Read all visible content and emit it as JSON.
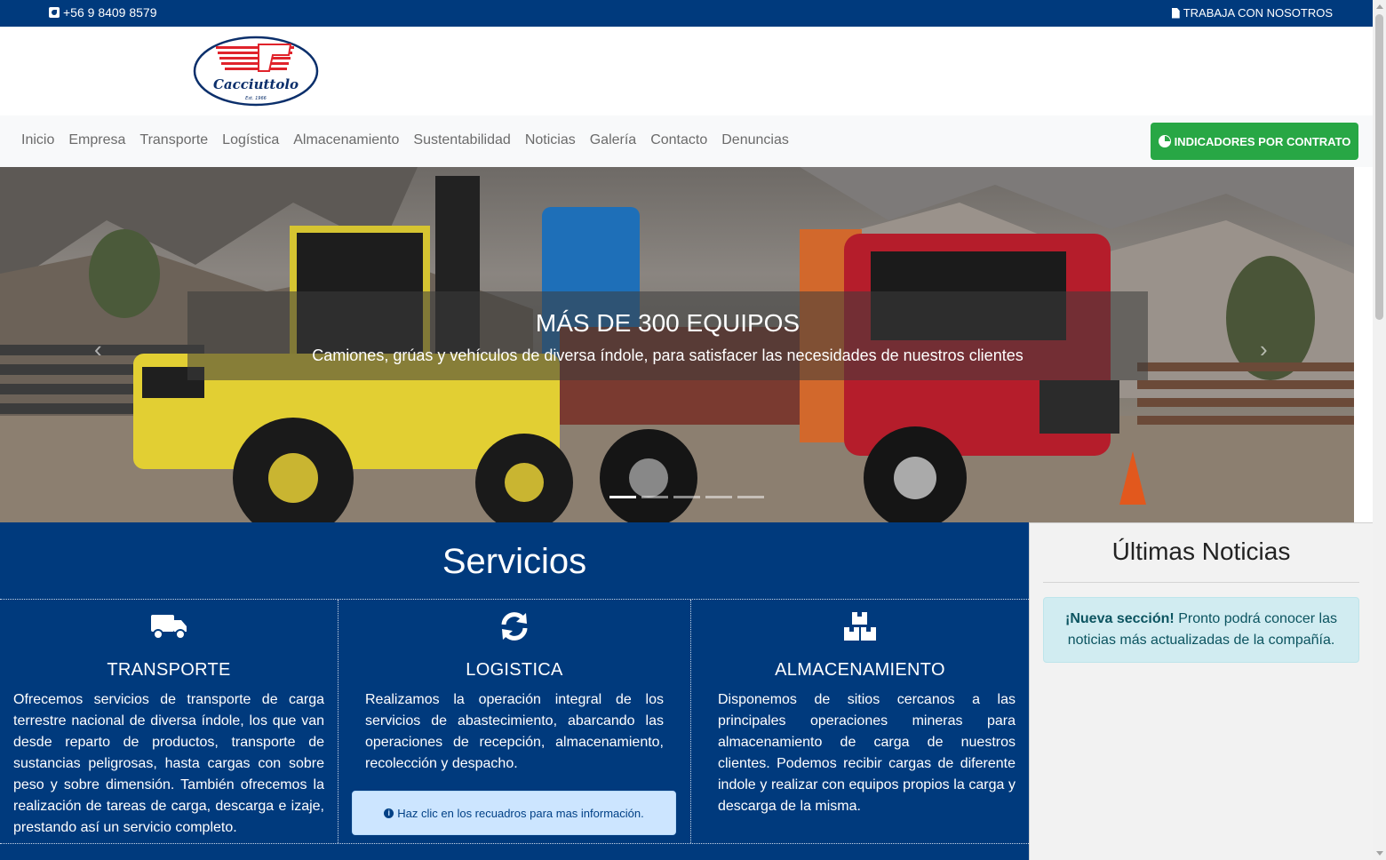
{
  "topbar": {
    "phone": "+56 9 8409 8579",
    "jobs_link": "TRABAJA CON NOSOTROS"
  },
  "logo": {
    "brand": "Cacciuttolo",
    "est": "Est. 1966"
  },
  "nav": {
    "items": [
      "Inicio",
      "Empresa",
      "Transporte",
      "Logística",
      "Almacenamiento",
      "Sustentabilidad",
      "Noticias",
      "Galería",
      "Contacto",
      "Denuncias"
    ],
    "cta": "INDICADORES POR CONTRATO"
  },
  "hero": {
    "title": "MÁS DE 300 EQUIPOS",
    "subtitle": "Camiones, grúas y vehículos de diversa índole, para satisfacer las necesidades de nuestros clientes",
    "slide_count": 5,
    "active_slide": 1
  },
  "services": {
    "heading": "Servicios",
    "items": [
      {
        "icon": "truck-icon",
        "title": "TRANSPORTE",
        "text": "Ofrecemos servicios de transporte de carga terrestre nacional de diversa índole, los que van desde reparto de productos, transporte de sustancias peligrosas, hasta cargas con sobre peso y sobre dimensión. También ofrecemos la realización de tareas de carga, descarga e izaje, prestando así un servicio completo."
      },
      {
        "icon": "sync-icon",
        "title": "LOGISTICA",
        "text": "Realizamos la operación integral de los servicios de abastecimiento, abarcando las operaciones de recepción, almacenamiento, recolección y despacho."
      },
      {
        "icon": "boxes-icon",
        "title": "ALMACENAMIENTO",
        "text": "Disponemos de sitios cercanos a las principales operaciones mineras para almacenamiento de carga de nuestros clientes. Podemos recibir cargas de diferente indole y realizar con equipos propios la carga y descarga de la misma."
      }
    ],
    "hint": "Haz clic en los recuadros para mas información."
  },
  "news": {
    "heading": "Últimas Noticias",
    "alert_strong": "¡Nueva sección!",
    "alert_text": "Pronto podrá conocer las noticias más actualizadas de la compañía."
  },
  "colors": {
    "brand_blue": "#003a7d",
    "cta_green": "#28a745"
  }
}
